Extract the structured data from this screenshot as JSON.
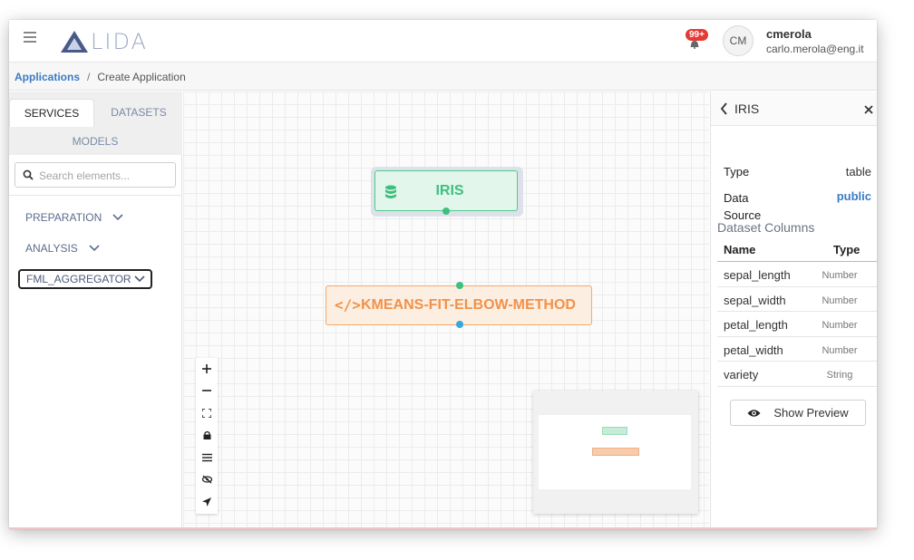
{
  "app": {
    "logo_text": "LIDA",
    "brand_color": "#4a5a86"
  },
  "header": {
    "notifications_badge": "99+",
    "avatar_initials": "CM",
    "user_name": "cmerola",
    "user_email": "carlo.merola@eng.it"
  },
  "breadcrumb": {
    "root": "Applications",
    "separator": "/",
    "current": "Create Application"
  },
  "sidebar": {
    "tabs": [
      {
        "label": "SERVICES",
        "active": true
      },
      {
        "label": "DATASETS",
        "active": false
      },
      {
        "label": "MODELS",
        "active": false
      }
    ],
    "search_placeholder": "Search elements...",
    "categories": [
      {
        "label": "PREPARATION"
      },
      {
        "label": "ANALYSIS"
      },
      {
        "label": "FML_AGGREGATOR"
      }
    ]
  },
  "canvas": {
    "nodes": [
      {
        "label": "IRIS",
        "kind": "dataset",
        "icon": "database-icon",
        "color": "#3fbf7f"
      },
      {
        "label": "KMEANS-FIT-ELBOW-METHOD",
        "kind": "service",
        "icon": "code-icon",
        "icon_glyph": "</>",
        "color": "#f0924a"
      }
    ],
    "controls": [
      "zoom-in-icon",
      "zoom-out-icon",
      "fit-view-icon",
      "lock-icon",
      "layers-icon",
      "hide-icon",
      "navigate-icon"
    ]
  },
  "panel": {
    "title": "IRIS",
    "properties": [
      {
        "label": "Type",
        "value": "table"
      },
      {
        "label": "Data Source",
        "value": "public"
      }
    ],
    "columns_title": "Dataset Columns",
    "column_headers": {
      "name": "Name",
      "type": "Type"
    },
    "columns": [
      {
        "name": "sepal_length",
        "type": "Number"
      },
      {
        "name": "sepal_width",
        "type": "Number"
      },
      {
        "name": "petal_length",
        "type": "Number"
      },
      {
        "name": "petal_width",
        "type": "Number"
      },
      {
        "name": "variety",
        "type": "String"
      }
    ],
    "preview_button": "Show Preview"
  }
}
